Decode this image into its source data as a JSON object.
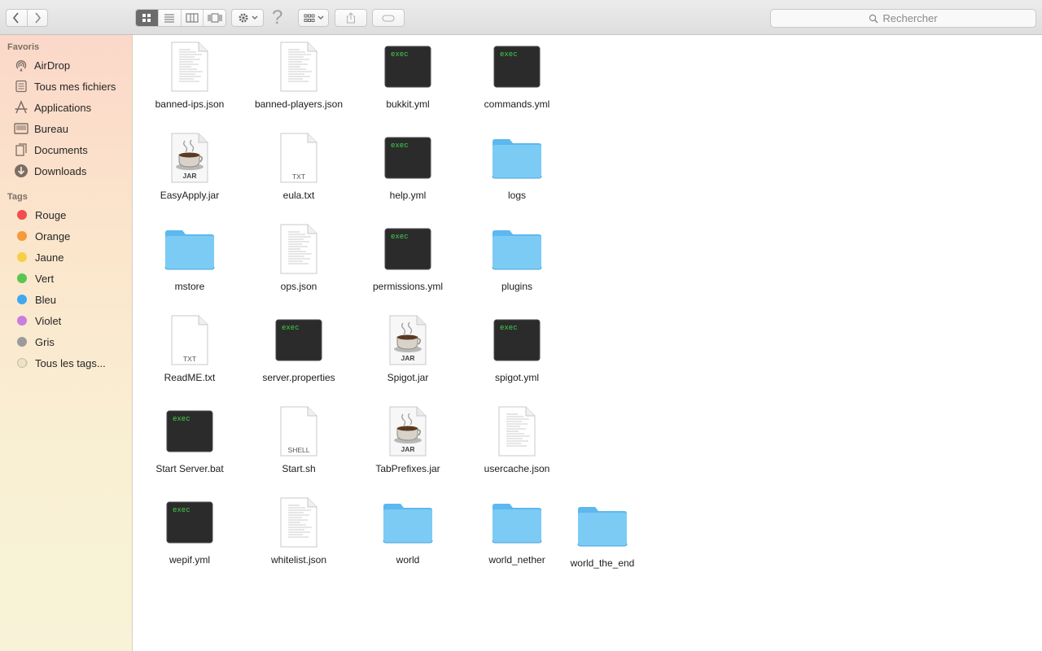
{
  "toolbar": {
    "back_icon": "chevron-left-icon",
    "forward_icon": "chevron-right-icon",
    "view_modes": [
      "icon-view-icon",
      "list-view-icon",
      "column-view-icon",
      "coverflow-view-icon"
    ],
    "active_view": "icon-view-icon",
    "help_glyph": "?",
    "search_placeholder": "Rechercher"
  },
  "sidebar": {
    "favorites_title": "Favoris",
    "favorites": [
      {
        "label": "AirDrop",
        "icon": "airdrop-icon"
      },
      {
        "label": "Tous mes fichiers",
        "icon": "all-files-icon"
      },
      {
        "label": "Applications",
        "icon": "applications-icon"
      },
      {
        "label": "Bureau",
        "icon": "desktop-icon"
      },
      {
        "label": "Documents",
        "icon": "documents-icon"
      },
      {
        "label": "Downloads",
        "icon": "downloads-icon"
      }
    ],
    "tags_title": "Tags",
    "tags": [
      {
        "label": "Rouge",
        "color": "#f24e4e"
      },
      {
        "label": "Orange",
        "color": "#f5993b"
      },
      {
        "label": "Jaune",
        "color": "#f5cf45"
      },
      {
        "label": "Vert",
        "color": "#5bc552"
      },
      {
        "label": "Bleu",
        "color": "#3fa9f0"
      },
      {
        "label": "Violet",
        "color": "#c97de0"
      },
      {
        "label": "Gris",
        "color": "#9b9b9b"
      },
      {
        "label": "Tous les tags...",
        "color": "all"
      }
    ]
  },
  "files": [
    {
      "name": "banned-ips.json",
      "type": "doc"
    },
    {
      "name": "banned-players.json",
      "type": "doc"
    },
    {
      "name": "bukkit.yml",
      "type": "exec"
    },
    {
      "name": "commands.yml",
      "type": "exec"
    },
    {
      "name": "EasyApply.jar",
      "type": "jar"
    },
    {
      "name": "eula.txt",
      "type": "txt"
    },
    {
      "name": "help.yml",
      "type": "exec"
    },
    {
      "name": "logs",
      "type": "folder"
    },
    {
      "name": "mstore",
      "type": "folder"
    },
    {
      "name": "ops.json",
      "type": "doc"
    },
    {
      "name": "permissions.yml",
      "type": "exec"
    },
    {
      "name": "plugins",
      "type": "folder"
    },
    {
      "name": "ReadME.txt",
      "type": "txt"
    },
    {
      "name": "server.properties",
      "type": "exec"
    },
    {
      "name": "Spigot.jar",
      "type": "jar"
    },
    {
      "name": "spigot.yml",
      "type": "exec"
    },
    {
      "name": "Start Server.bat",
      "type": "exec"
    },
    {
      "name": "Start.sh",
      "type": "shell"
    },
    {
      "name": "TabPrefixes.jar",
      "type": "jar"
    },
    {
      "name": "usercache.json",
      "type": "doc"
    },
    {
      "name": "wepif.yml",
      "type": "exec"
    },
    {
      "name": "whitelist.json",
      "type": "doc"
    },
    {
      "name": "world",
      "type": "folder"
    },
    {
      "name": "world_nether",
      "type": "folder"
    },
    {
      "name": "world_the_end",
      "type": "folder"
    }
  ],
  "icon_text": {
    "exec": "exec",
    "jar": "JAR",
    "txt": "TXT",
    "shell": "SHELL"
  }
}
